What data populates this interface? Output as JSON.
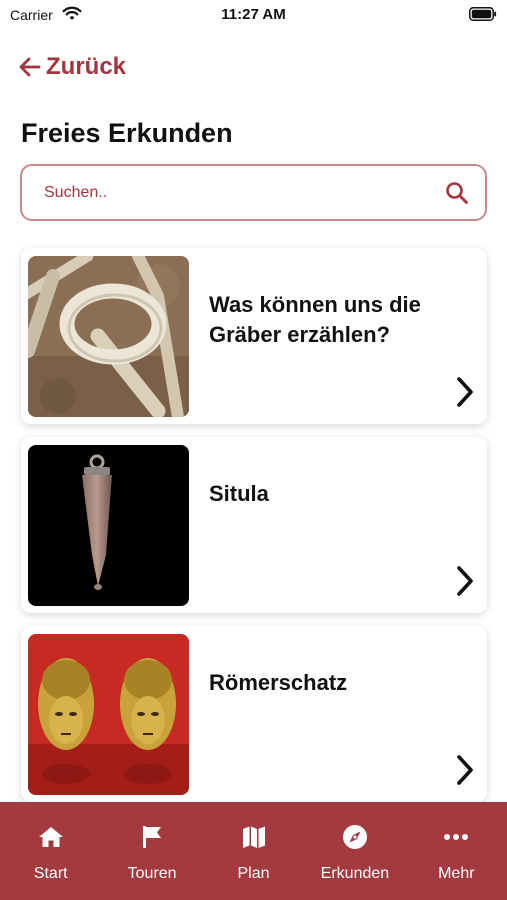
{
  "status_bar": {
    "carrier": "Carrier",
    "time": "11:27 AM"
  },
  "nav": {
    "back_label": "Zurück"
  },
  "page": {
    "title": "Freies Erkunden"
  },
  "search": {
    "placeholder": "Suchen..",
    "value": ""
  },
  "cards": [
    {
      "title": "Was können uns die Gräber erzählen?",
      "thumbnail": "grave-ring-photo"
    },
    {
      "title": "Situla",
      "thumbnail": "situla-photo"
    },
    {
      "title": "Römerschatz",
      "thumbnail": "roman-masks-photo"
    }
  ],
  "tab_bar": {
    "tabs": [
      {
        "label": "Start",
        "icon": "home-icon"
      },
      {
        "label": "Touren",
        "icon": "flag-icon"
      },
      {
        "label": "Plan",
        "icon": "map-icon"
      },
      {
        "label": "Erkunden",
        "icon": "compass-icon"
      },
      {
        "label": "Mehr",
        "icon": "more-dots-icon"
      }
    ]
  },
  "colors": {
    "accent": "#a3353f",
    "tab_bar": "#a23a40",
    "search_border": "#c98a8f"
  }
}
